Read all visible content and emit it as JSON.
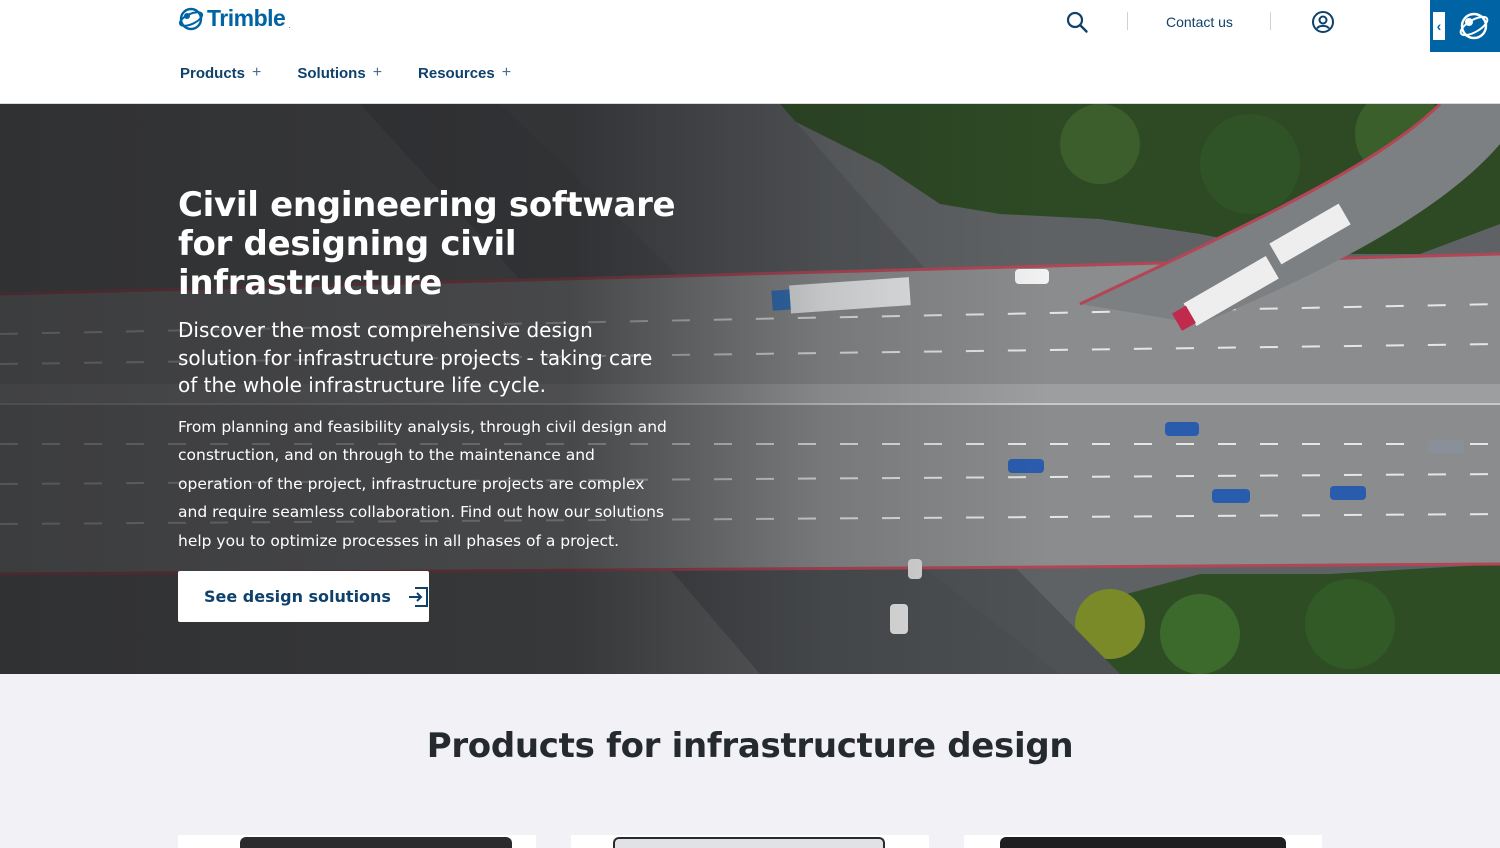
{
  "brand": {
    "name": "Trimble",
    "trademark": ".",
    "color": "#0063a3",
    "navy": "#0e416c"
  },
  "header": {
    "search_icon": "search-icon",
    "contact_label": "Contact us",
    "account_icon": "user-circle-icon",
    "side_tab_icon": "chevron-left-icon",
    "nav": [
      {
        "label": "Products",
        "icon": "plus-icon",
        "plus": "+"
      },
      {
        "label": "Solutions",
        "icon": "plus-icon",
        "plus": "+"
      },
      {
        "label": "Resources",
        "icon": "plus-icon",
        "plus": "+"
      }
    ]
  },
  "hero": {
    "title": "Civil engineering software for designing civil infrastructure",
    "subtitle": "Discover the most comprehensive design solution for infrastructure projects - taking care of the whole infrastructure life cycle.",
    "body": "From planning and feasibility analysis, through civil design and construction, and on through to the maintenance and operation of the project, infrastructure projects are complex and require seamless collaboration. Find out how our solutions help you to optimize processes in all phases of a project.",
    "cta_label": "See design solutions",
    "cta_icon": "arrow-right-box-icon"
  },
  "products": {
    "title": "Products for infrastructure design"
  }
}
